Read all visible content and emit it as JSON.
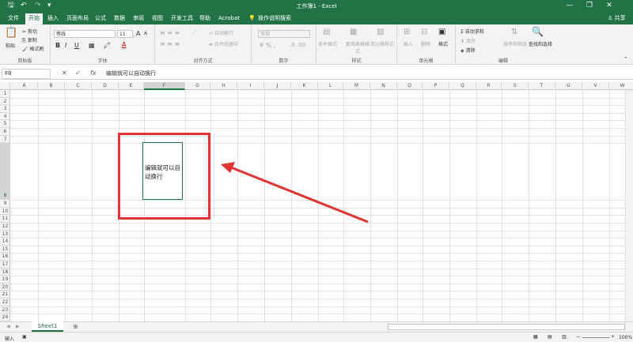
{
  "app": {
    "title": "工作簿1  -  Excel"
  },
  "quick_access": {
    "save": "🖫",
    "undo": "↶",
    "redo": "↷",
    "customize": "▾"
  },
  "window_controls": {
    "minimize": "—",
    "restore": "❐",
    "close": "✕"
  },
  "account": {
    "share": "♙ 共享"
  },
  "tabs": [
    "文件",
    "开始",
    "插入",
    "页面布局",
    "公式",
    "数据",
    "审阅",
    "视图",
    "开发工具",
    "帮助",
    "Acrobat"
  ],
  "tell_me": "操作说明搜索",
  "ribbon": {
    "clipboard": {
      "label": "剪贴板",
      "paste": "粘贴",
      "cut": "剪切",
      "copy": "复制",
      "format_painter": "格式刷"
    },
    "font": {
      "label": "字体",
      "font_name": "等线",
      "font_size": "11",
      "bold": "B",
      "italic": "I",
      "underline": "U",
      "grow": "A",
      "shrink": "A"
    },
    "alignment": {
      "label": "对齐方式",
      "wrap": "自动换行",
      "merge": "合并后居中"
    },
    "number": {
      "label": "数字",
      "format": "常规"
    },
    "styles": {
      "label": "样式",
      "conditional": "条件格式",
      "table": "套用表格格式",
      "cell_style": "单元格样式"
    },
    "cells": {
      "label": "单元格",
      "insert": "插入",
      "delete": "删除",
      "format": "格式"
    },
    "editing": {
      "label": "编辑",
      "autosum": "自动求和",
      "fill": "填充",
      "clear": "清除",
      "sort": "排序和筛选",
      "find": "查找和选择"
    }
  },
  "formula_bar": {
    "name_box": "F8",
    "fx": "fx",
    "content": "编辑就可以自动换行"
  },
  "columns": [
    "A",
    "B",
    "C",
    "D",
    "E",
    "F",
    "G",
    "H",
    "I",
    "J",
    "K",
    "L",
    "M",
    "N",
    "O",
    "P",
    "Q",
    "R",
    "S",
    "T",
    "U",
    "V",
    "W"
  ],
  "rows": [
    "1",
    "2",
    "3",
    "4",
    "5",
    "6",
    "7",
    "8",
    "9",
    "10",
    "11",
    "12",
    "13",
    "14",
    "15",
    "16",
    "17",
    "18",
    "19",
    "20",
    "21",
    "22",
    "23",
    "24"
  ],
  "cell_text": "编辑就可以自动换行",
  "selected_column": "F",
  "selected_row": "8",
  "sheet_tabs": [
    "Sheet1"
  ],
  "status": {
    "mode": "输入",
    "zoom": "100%"
  },
  "colors": {
    "brand": "#217346",
    "annotation": "#e03333"
  }
}
